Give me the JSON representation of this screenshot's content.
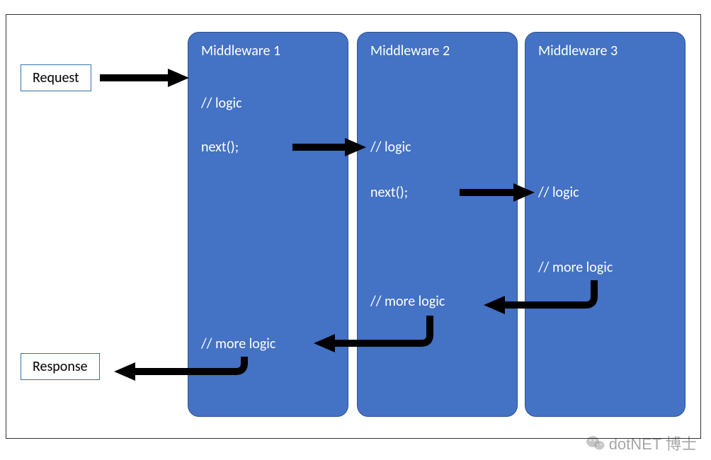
{
  "request_label": "Request",
  "response_label": "Response",
  "middleware": [
    {
      "title": "Middleware 1",
      "logic": "// logic",
      "next": "next();",
      "more": "// more logic"
    },
    {
      "title": "Middleware 2",
      "logic": "// logic",
      "next": "next();",
      "more": "// more logic"
    },
    {
      "title": "Middleware 3",
      "logic": "// logic",
      "more": "// more logic"
    }
  ],
  "watermark": "dotNET 博士",
  "colors": {
    "box_fill": "#4472c4",
    "box_border": "#2f528f",
    "io_border": "#2e74b5",
    "arrow": "#000000"
  }
}
